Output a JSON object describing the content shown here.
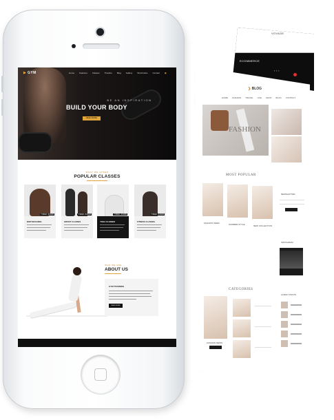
{
  "back_page": {
    "heading": "ECOMMERCE",
    "tiny_text": "VOYAGE",
    "accent": "#e0312a"
  },
  "blog_page": {
    "logo_prefix": "❯",
    "logo_text": "BLOG",
    "nav": [
      "HOME",
      "FASHION",
      "TRAVEL",
      "LIFE",
      "SHOP",
      "BLOG",
      "CONTACT"
    ],
    "hero_word": "FASHION",
    "section_popular": "MOST POPULAR",
    "section_categories": "CATEGORIES",
    "sidebar_newsletter": "NEWSLETTER",
    "sidebar_instagram": "INSTAGRAM",
    "sidebar_latest": "LATEST POSTS",
    "card_captions": [
      "FASHION WEEK",
      "SUMMER STYLE",
      "NEW COLLECTION"
    ],
    "category_caption": "FASHION NEWS",
    "accent": "#c58a2c"
  },
  "gym_site": {
    "brand_icon": "▶",
    "brand": "GYM",
    "menu": [
      "Home",
      "Features",
      "Classes",
      "Timeline",
      "Blog",
      "Gallery",
      "Shortcodes",
      "Contact"
    ],
    "hero_sub": "BE AN INSPIRATION",
    "hero_title": "BUILD YOUR BODY",
    "hero_cta": "READ MORE",
    "popular_kicker": "WHAT WE OFFER",
    "popular_title": "POPULAR CLASSES",
    "classes": [
      {
        "name": "BODYBUILDING",
        "tag": "7:30AM - 9:00AM"
      },
      {
        "name": "GROUP CLASSES",
        "tag": "7:30AM - 9:00AM"
      },
      {
        "name": "YOGA CLASSES",
        "tag": "7:30AM - 9:00AM"
      },
      {
        "name": "FITNESS CLASSES",
        "tag": "7:30AM - 9:00AM"
      }
    ],
    "about_kicker": "WHO WE ARE",
    "about_title": "ABOUT US",
    "about_box_title": "GYM TRAINING",
    "about_button": "READ MORE",
    "accent": "#e0a43a"
  }
}
